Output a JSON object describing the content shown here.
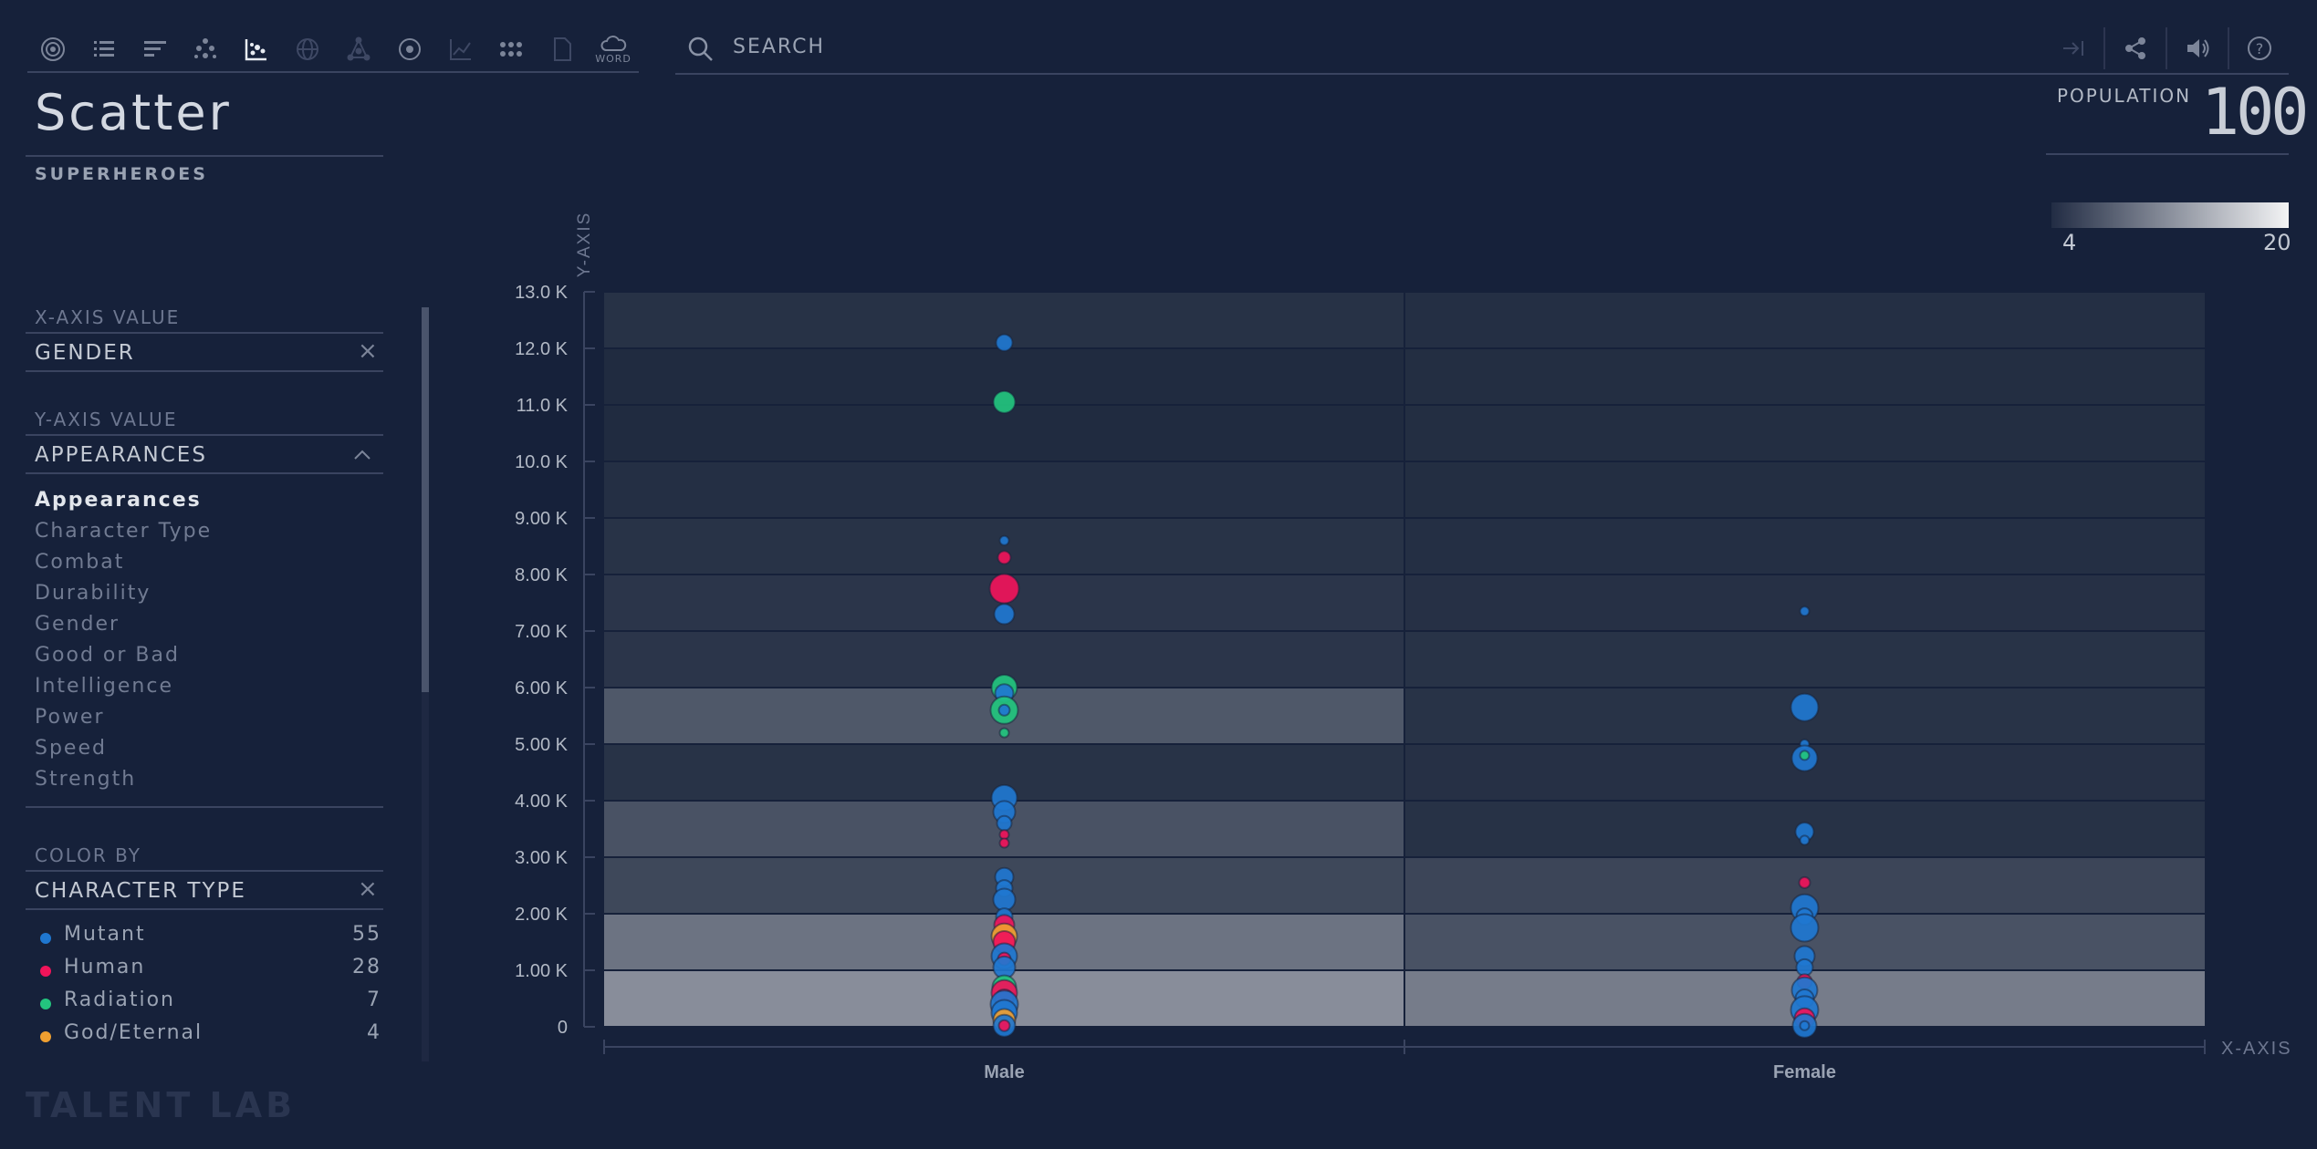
{
  "toolbar": {
    "icons": [
      "target-icon",
      "list-icon",
      "bars-icon",
      "dots-icon",
      "scatter-icon",
      "globe-icon",
      "network-icon",
      "circle-dot-icon",
      "line-chart-icon",
      "grid-dots-icon",
      "document-icon",
      "word-cloud-icon"
    ],
    "word_label": "WORD"
  },
  "search": {
    "placeholder": "SEARCH"
  },
  "header_right": {
    "icons": [
      "export-icon",
      "share-icon",
      "sound-icon",
      "help-icon"
    ]
  },
  "panel": {
    "title": "Scatter",
    "subtitle": "SUPERHEROES",
    "x_axis": {
      "label": "X-AXIS VALUE",
      "value": "GENDER"
    },
    "y_axis": {
      "label": "Y-AXIS VALUE",
      "value": "APPEARANCES",
      "options": [
        "Appearances",
        "Character Type",
        "Combat",
        "Durability",
        "Gender",
        "Good or Bad",
        "Intelligence",
        "Power",
        "Speed",
        "Strength"
      ],
      "selected": "Appearances"
    },
    "color_by": {
      "label": "COLOR BY",
      "value": "CHARACTER TYPE",
      "legend": [
        {
          "name": "Mutant",
          "count": "55",
          "color": "#1f77d0"
        },
        {
          "name": "Human",
          "count": "28",
          "color": "#f0145a"
        },
        {
          "name": "Radiation",
          "count": "7",
          "color": "#23c47e"
        },
        {
          "name": "God/Eternal",
          "count": "4",
          "color": "#f0a030"
        }
      ]
    }
  },
  "brand": "TALENT LAB",
  "population": {
    "label": "POPULATION",
    "value": "100"
  },
  "density_scale": {
    "min": "4",
    "max": "20"
  },
  "chart_data": {
    "type": "scatter",
    "x_axis_title": "X-AXIS",
    "y_axis_title": "Y-AXIS",
    "categories": [
      "Male",
      "Female"
    ],
    "ylim": [
      0,
      13000
    ],
    "y_ticks": [
      {
        "value": 0,
        "label": "0"
      },
      {
        "value": 1000,
        "label": "1.00 K"
      },
      {
        "value": 2000,
        "label": "2.00 K"
      },
      {
        "value": 3000,
        "label": "3.00 K"
      },
      {
        "value": 4000,
        "label": "4.00 K"
      },
      {
        "value": 5000,
        "label": "5.00 K"
      },
      {
        "value": 6000,
        "label": "6.00 K"
      },
      {
        "value": 7000,
        "label": "7.00 K"
      },
      {
        "value": 8000,
        "label": "8.00 K"
      },
      {
        "value": 9000,
        "label": "9.00 K"
      },
      {
        "value": 10000,
        "label": "10.0 K"
      },
      {
        "value": 11000,
        "label": "11.0 K"
      },
      {
        "value": 12000,
        "label": "12.0 K"
      },
      {
        "value": 13000,
        "label": "13.0 K"
      }
    ],
    "density_bands": {
      "Male": [
        0.75,
        0.55,
        0.22,
        0.3,
        0.06,
        0.34,
        0.08,
        0.08,
        0.06,
        0.03,
        0.0,
        0.0,
        0.05
      ],
      "Female": [
        0.62,
        0.3,
        0.2,
        0.05,
        0.04,
        0.06,
        0.06,
        0.04,
        0.03,
        0.02,
        0.02,
        0.02,
        0.03
      ]
    },
    "points": [
      {
        "x": "Male",
        "y": 12100,
        "size": 9,
        "type": "Mutant"
      },
      {
        "x": "Male",
        "y": 11050,
        "size": 12,
        "type": "Radiation"
      },
      {
        "x": "Male",
        "y": 8600,
        "size": 5,
        "type": "Mutant"
      },
      {
        "x": "Male",
        "y": 8300,
        "size": 7,
        "type": "Human"
      },
      {
        "x": "Male",
        "y": 7750,
        "size": 16,
        "type": "Human"
      },
      {
        "x": "Male",
        "y": 7300,
        "size": 11,
        "type": "Mutant"
      },
      {
        "x": "Male",
        "y": 6000,
        "size": 14,
        "type": "Radiation"
      },
      {
        "x": "Male",
        "y": 5900,
        "size": 10,
        "type": "Mutant"
      },
      {
        "x": "Male",
        "y": 5600,
        "size": 15,
        "type": "Radiation"
      },
      {
        "x": "Male",
        "y": 5600,
        "size": 6,
        "type": "Mutant"
      },
      {
        "x": "Male",
        "y": 5200,
        "size": 5,
        "type": "Radiation"
      },
      {
        "x": "Male",
        "y": 4050,
        "size": 14,
        "type": "Mutant"
      },
      {
        "x": "Male",
        "y": 3800,
        "size": 12,
        "type": "Mutant"
      },
      {
        "x": "Male",
        "y": 3600,
        "size": 8,
        "type": "Mutant"
      },
      {
        "x": "Male",
        "y": 3400,
        "size": 5,
        "type": "Human"
      },
      {
        "x": "Male",
        "y": 3250,
        "size": 5,
        "type": "Human"
      },
      {
        "x": "Male",
        "y": 2650,
        "size": 10,
        "type": "Mutant"
      },
      {
        "x": "Male",
        "y": 2450,
        "size": 9,
        "type": "Mutant"
      },
      {
        "x": "Male",
        "y": 2250,
        "size": 12,
        "type": "Mutant"
      },
      {
        "x": "Male",
        "y": 1950,
        "size": 9,
        "type": "Mutant"
      },
      {
        "x": "Male",
        "y": 1800,
        "size": 11,
        "type": "Human"
      },
      {
        "x": "Male",
        "y": 1600,
        "size": 14,
        "type": "God/Eternal"
      },
      {
        "x": "Male",
        "y": 1500,
        "size": 12,
        "type": "Human"
      },
      {
        "x": "Male",
        "y": 1250,
        "size": 14,
        "type": "Mutant"
      },
      {
        "x": "Male",
        "y": 1200,
        "size": 7,
        "type": "Human"
      },
      {
        "x": "Male",
        "y": 1050,
        "size": 12,
        "type": "Mutant"
      },
      {
        "x": "Male",
        "y": 700,
        "size": 13,
        "type": "Radiation"
      },
      {
        "x": "Male",
        "y": 600,
        "size": 14,
        "type": "Human"
      },
      {
        "x": "Male",
        "y": 500,
        "size": 10,
        "type": "Human"
      },
      {
        "x": "Male",
        "y": 400,
        "size": 15,
        "type": "Mutant"
      },
      {
        "x": "Male",
        "y": 250,
        "size": 14,
        "type": "Mutant"
      },
      {
        "x": "Male",
        "y": 120,
        "size": 12,
        "type": "God/Eternal"
      },
      {
        "x": "Male",
        "y": 20,
        "size": 12,
        "type": "Mutant"
      },
      {
        "x": "Male",
        "y": 20,
        "size": 6,
        "type": "Human"
      },
      {
        "x": "Female",
        "y": 7350,
        "size": 5,
        "type": "Mutant"
      },
      {
        "x": "Female",
        "y": 5650,
        "size": 15,
        "type": "Mutant"
      },
      {
        "x": "Female",
        "y": 5000,
        "size": 5,
        "type": "Mutant"
      },
      {
        "x": "Female",
        "y": 4750,
        "size": 14,
        "type": "Mutant"
      },
      {
        "x": "Female",
        "y": 4800,
        "size": 5,
        "type": "Radiation"
      },
      {
        "x": "Female",
        "y": 3450,
        "size": 10,
        "type": "Mutant"
      },
      {
        "x": "Female",
        "y": 3300,
        "size": 5,
        "type": "Mutant"
      },
      {
        "x": "Female",
        "y": 2550,
        "size": 6,
        "type": "Human"
      },
      {
        "x": "Female",
        "y": 2100,
        "size": 15,
        "type": "Mutant"
      },
      {
        "x": "Female",
        "y": 1950,
        "size": 9,
        "type": "Mutant"
      },
      {
        "x": "Female",
        "y": 1750,
        "size": 15,
        "type": "Mutant"
      },
      {
        "x": "Female",
        "y": 1250,
        "size": 11,
        "type": "Mutant"
      },
      {
        "x": "Female",
        "y": 1050,
        "size": 9,
        "type": "Mutant"
      },
      {
        "x": "Female",
        "y": 800,
        "size": 8,
        "type": "Human"
      },
      {
        "x": "Female",
        "y": 650,
        "size": 14,
        "type": "Mutant"
      },
      {
        "x": "Female",
        "y": 500,
        "size": 10,
        "type": "Mutant"
      },
      {
        "x": "Female",
        "y": 300,
        "size": 15,
        "type": "Mutant"
      },
      {
        "x": "Female",
        "y": 150,
        "size": 11,
        "type": "Human"
      },
      {
        "x": "Female",
        "y": 20,
        "size": 13,
        "type": "Mutant"
      },
      {
        "x": "Female",
        "y": 20,
        "size": 5,
        "type": "Mutant"
      }
    ]
  }
}
